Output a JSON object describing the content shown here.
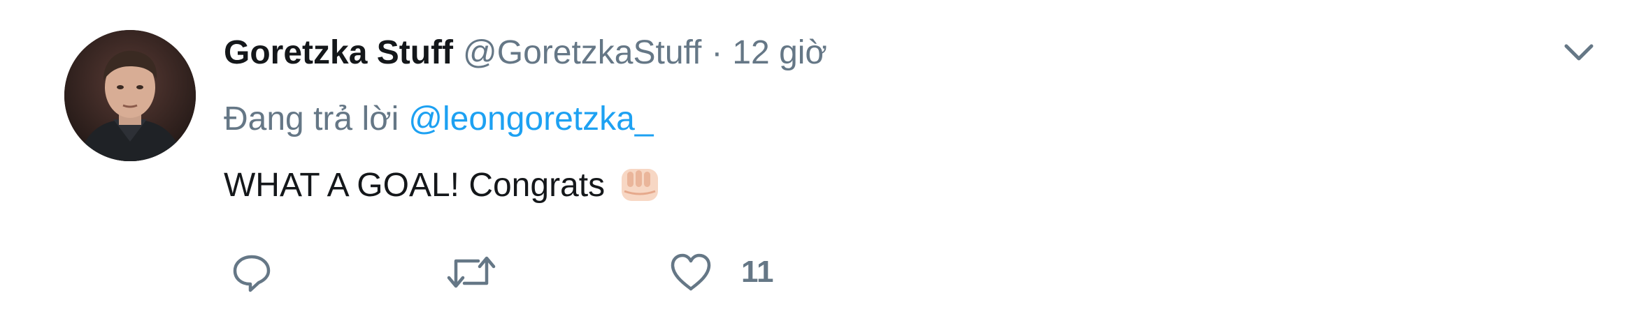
{
  "tweet": {
    "display_name": "Goretzka Stuff",
    "handle": "@GoretzkaStuff",
    "separator": "·",
    "time": "12 giờ",
    "reply_prefix": "Đang trả lời",
    "reply_to": "@leongoretzka_",
    "text": "WHAT A GOAL! Congrats",
    "emoji_icon": "oncoming-fist-icon",
    "like_count": "11"
  },
  "icons": {
    "caret": "chevron-down-icon",
    "reply": "reply-icon",
    "retweet": "retweet-icon",
    "like": "heart-icon"
  },
  "colors": {
    "text_primary": "#14171a",
    "text_secondary": "#657786",
    "link": "#1da1f2",
    "background": "#ffffff"
  }
}
